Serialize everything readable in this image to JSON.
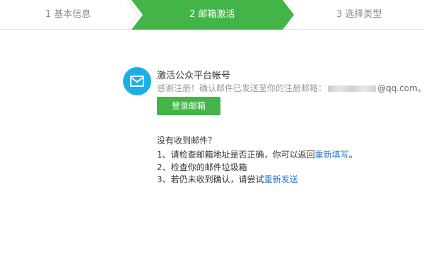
{
  "stepper": {
    "steps": [
      {
        "label": "1 基本信息",
        "state": "done"
      },
      {
        "label": "2 邮箱激活",
        "state": "active"
      },
      {
        "label": "3 选择类型",
        "state": "todo"
      }
    ],
    "colors": {
      "active": "#43b548",
      "inactive_border": "#e3e3e3",
      "inactive_text": "#8a8a8a"
    }
  },
  "activation": {
    "icon": "mail-icon",
    "title": "激活公众平台帐号",
    "notice_prefix": "感谢注册！确认邮件已发送至你的注册邮箱：",
    "email_domain": "@qq.com。",
    "login_button": "登录邮箱"
  },
  "help": {
    "title": "没有收到邮件？",
    "item1_text": "1、请检查邮箱地址是否正确，你可以返回",
    "item1_link": "重新填写",
    "item1_suffix": "。",
    "item2_text": "2、检查你的邮件垃圾箱",
    "item3_text": "3、若仍未收到确认，请尝试",
    "item3_link": "重新发送"
  },
  "colors": {
    "accent_green": "#43b548",
    "icon_blue": "#1caee6",
    "link_blue": "#2b78c5"
  }
}
